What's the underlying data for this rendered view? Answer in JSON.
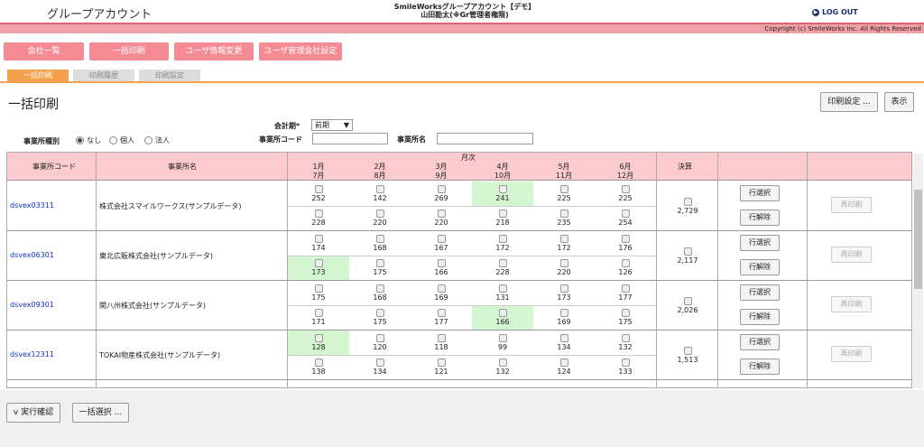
{
  "header": {
    "app_title": "グループアカウント",
    "company_line": "SmileWorksグループアカウント【デモ】",
    "user_line": "山田勘太(※Gr管理者権限)",
    "logout_label": "LOG OUT",
    "copyright": "Copyright (c) SmileWorks Inc. All Rights Reserved"
  },
  "nav_buttons": [
    "会社一覧",
    "一括印刷",
    "ユーザ情報変更",
    "ユーザ管理会社設定"
  ],
  "tabs": [
    "一括印刷",
    "印刷履歴",
    "印刷設定"
  ],
  "page_title": "一括印刷",
  "top_buttons": {
    "print_settings": "印刷設定 ...",
    "display": "表示"
  },
  "filters": {
    "fiscal_label": "会計期*",
    "fiscal_value": "前期",
    "office_type_label": "事業所種別",
    "radio_none": "なし",
    "radio_individual": "個人",
    "radio_corporate": "法人",
    "office_code_label": "事業所コード",
    "office_name_label": "事業所名"
  },
  "table": {
    "headers": {
      "code": "事業所コード",
      "name": "事業所名",
      "monthly": "月次",
      "settlement": "決算"
    },
    "month_pairs": [
      [
        "1月",
        "7月"
      ],
      [
        "2月",
        "8月"
      ],
      [
        "3月",
        "9月"
      ],
      [
        "4月",
        "10月"
      ],
      [
        "5月",
        "11月"
      ],
      [
        "6月",
        "12月"
      ]
    ],
    "row_select": "行選択",
    "row_clear": "行解除",
    "reprint": "再印刷",
    "rows": [
      {
        "code": "dsvex03311",
        "name": "株式会社スマイルワークス(サンプルデータ)",
        "top": [
          "252",
          "142",
          "269",
          "241",
          "225",
          "225"
        ],
        "bottom": [
          "228",
          "220",
          "220",
          "218",
          "235",
          "254"
        ],
        "green_top": [
          3
        ],
        "green_bottom": [],
        "settlement": "2,729"
      },
      {
        "code": "dsvex06301",
        "name": "東北広販株式会社(サンプルデータ)",
        "top": [
          "174",
          "168",
          "167",
          "172",
          "172",
          "176"
        ],
        "bottom": [
          "173",
          "175",
          "166",
          "228",
          "220",
          "126"
        ],
        "green_top": [],
        "green_bottom": [
          0
        ],
        "settlement": "2,117"
      },
      {
        "code": "dsvex09301",
        "name": "関八州株式会社(サンプルデータ)",
        "top": [
          "175",
          "168",
          "169",
          "131",
          "173",
          "177"
        ],
        "bottom": [
          "171",
          "175",
          "177",
          "166",
          "169",
          "175"
        ],
        "green_top": [],
        "green_bottom": [
          3
        ],
        "settlement": "2,026"
      },
      {
        "code": "dsvex12311",
        "name": "TOKAI物産株式会社(サンプルデータ)",
        "top": [
          "128",
          "120",
          "118",
          "99",
          "134",
          "132"
        ],
        "bottom": [
          "138",
          "134",
          "121",
          "132",
          "124",
          "133"
        ],
        "green_top": [
          0
        ],
        "green_bottom": [],
        "settlement": "1,513"
      }
    ]
  },
  "bottom_buttons": {
    "execute": "v 実行確認",
    "bulk_select": "一括選択 ..."
  }
}
